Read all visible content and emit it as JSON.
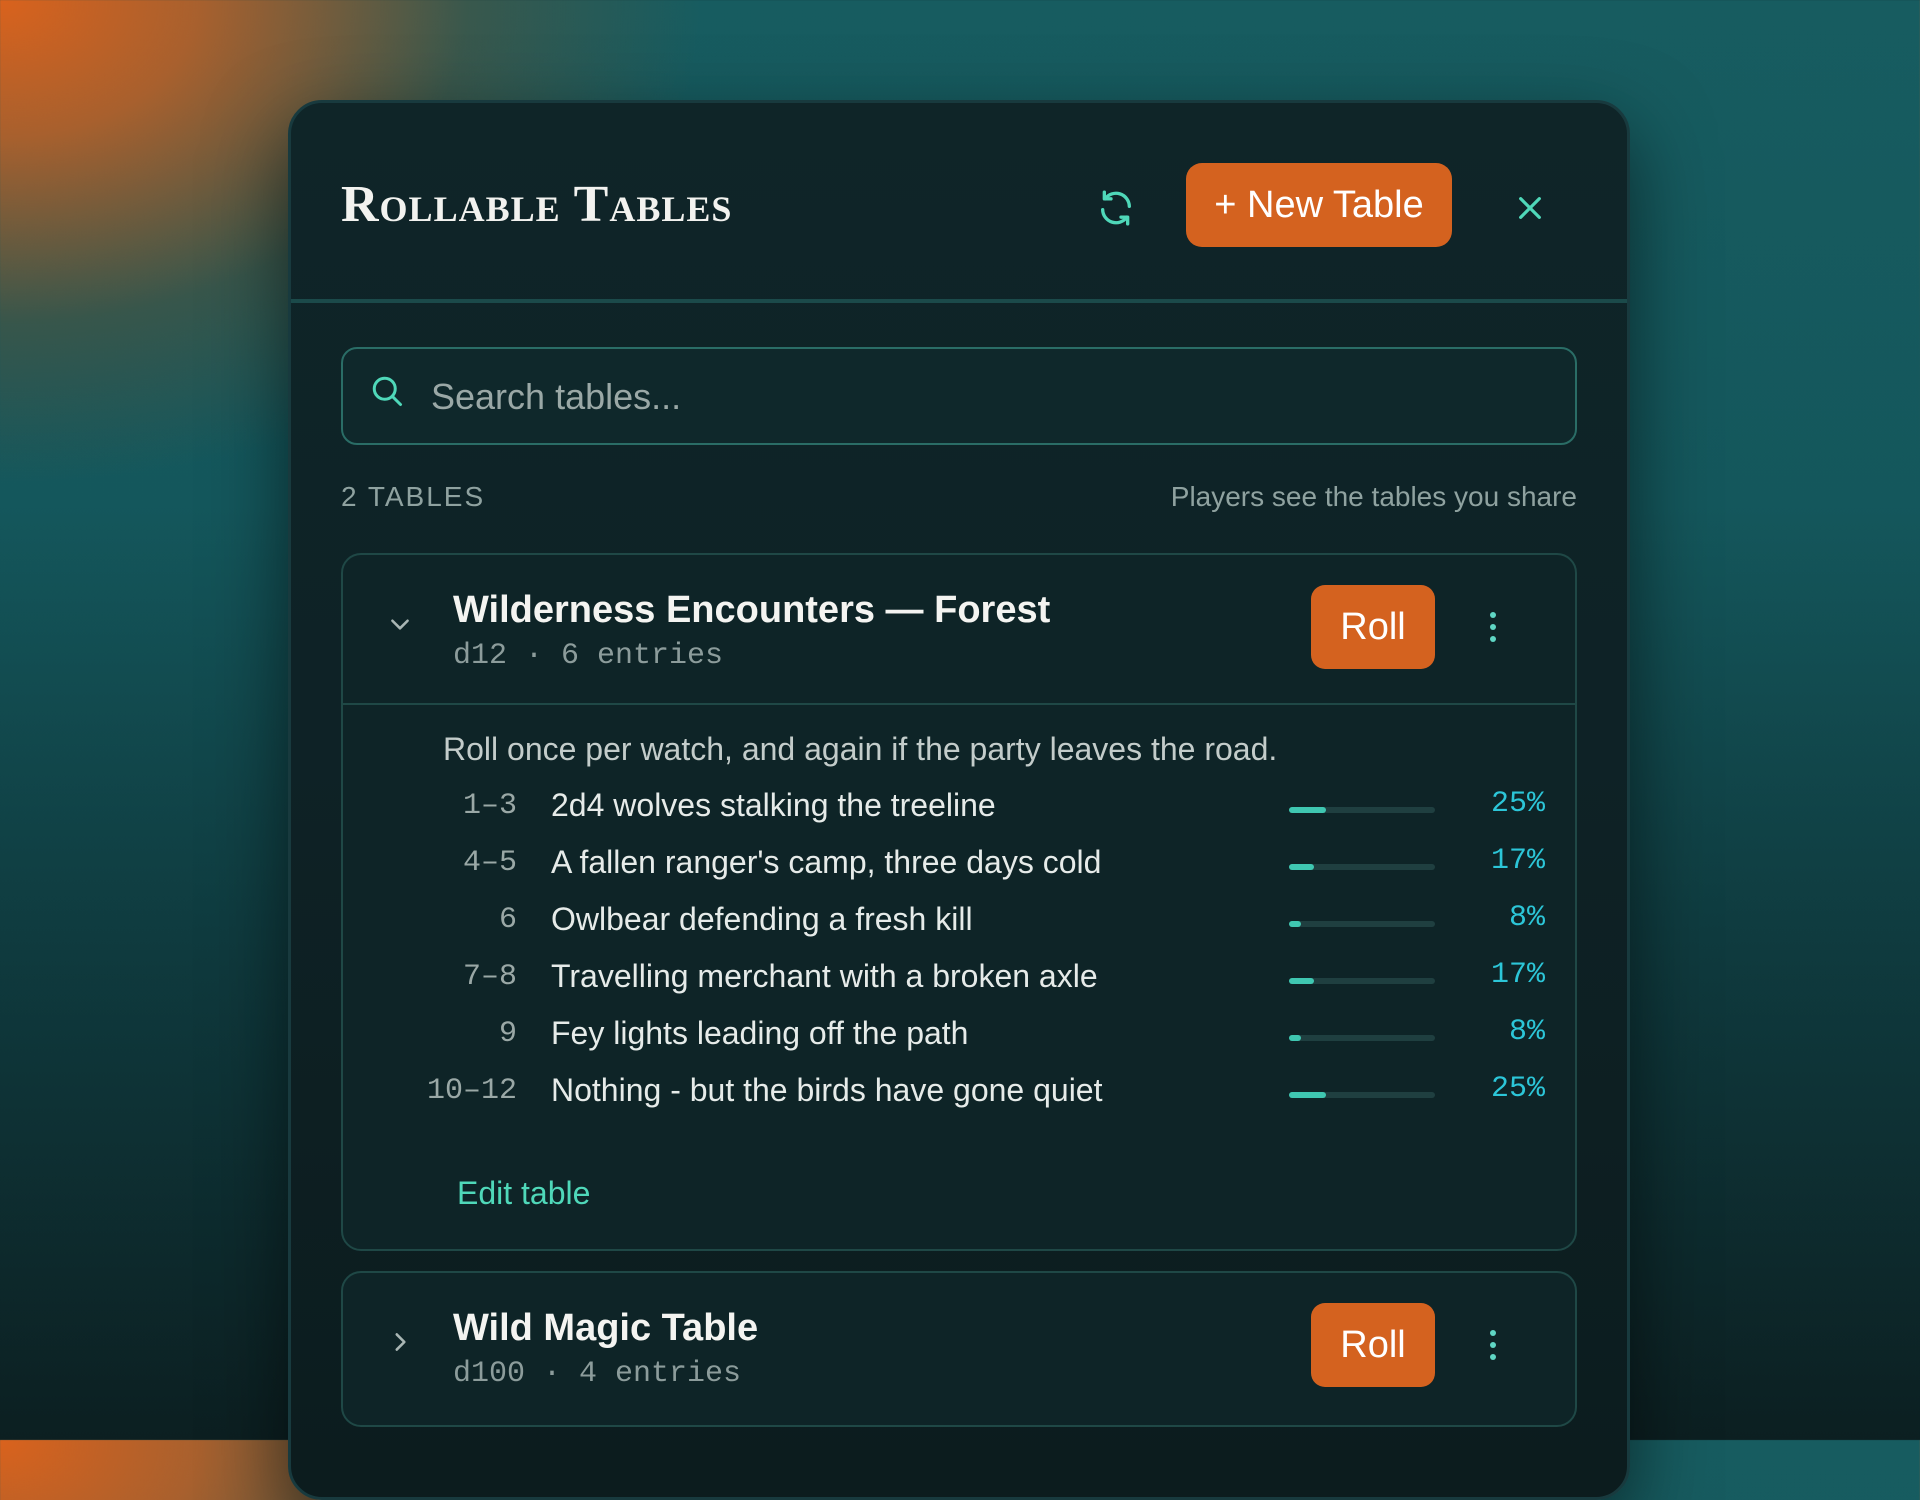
{
  "header": {
    "title": "Rollable Tables",
    "new_table_label": "+ New Table"
  },
  "search": {
    "placeholder": "Search tables..."
  },
  "summary": {
    "count_label": "2 TABLES",
    "share_note": "Players see the tables you share"
  },
  "tables": [
    {
      "name": "Wilderness Encounters — Forest",
      "meta": "d12 · 6 entries",
      "roll_label": "Roll",
      "expanded": true,
      "description": "Roll once per watch, and again if the party leaves the road.",
      "entries": [
        {
          "range": "1–3",
          "text": "2d4 wolves stalking the treeline",
          "percent": 25,
          "percent_label": "25%"
        },
        {
          "range": "4–5",
          "text": "A fallen ranger's camp, three days cold",
          "percent": 17,
          "percent_label": "17%"
        },
        {
          "range": "6",
          "text": "Owlbear defending a fresh kill",
          "percent": 8,
          "percent_label": "8%"
        },
        {
          "range": "7–8",
          "text": "Travelling merchant with a broken axle",
          "percent": 17,
          "percent_label": "17%"
        },
        {
          "range": "9",
          "text": "Fey lights leading off the path",
          "percent": 8,
          "percent_label": "8%"
        },
        {
          "range": "10–12",
          "text": "Nothing - but the birds have gone quiet",
          "percent": 25,
          "percent_label": "25%"
        }
      ],
      "edit_label": "Edit table"
    },
    {
      "name": "Wild Magic Table",
      "meta": "d100 · 4 entries",
      "roll_label": "Roll",
      "expanded": false
    }
  ],
  "icons": {
    "sync": "sync-icon",
    "close": "close-icon",
    "search": "search-icon",
    "expanded": "chevron-down-icon",
    "collapsed": "chevron-right-icon",
    "more": "more-vertical-icon"
  },
  "colors": {
    "accent": "#d4621f",
    "teal": "#4fd8b9",
    "percent": "#2cc6d8",
    "panel": "#0f2528"
  }
}
